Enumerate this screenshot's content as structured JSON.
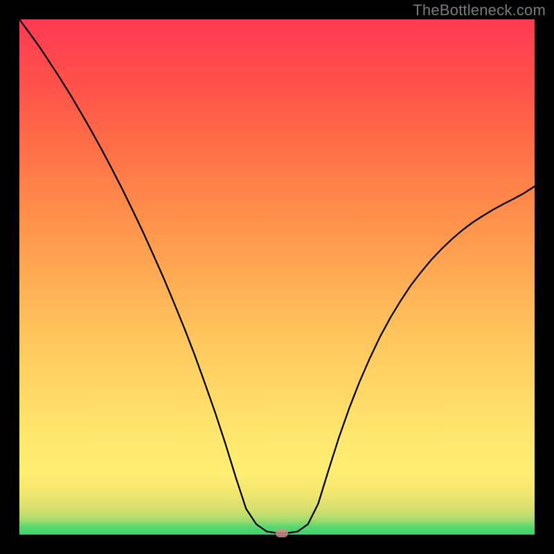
{
  "watermark": "TheBottleneck.com",
  "chart_data": {
    "type": "line",
    "title": "",
    "xlabel": "",
    "ylabel": "",
    "xlim": [
      0,
      1
    ],
    "ylim": [
      0,
      1
    ],
    "x": [
      0.0,
      0.02,
      0.04,
      0.06,
      0.08,
      0.1,
      0.12,
      0.14,
      0.16,
      0.18,
      0.2,
      0.22,
      0.24,
      0.26,
      0.28,
      0.3,
      0.32,
      0.34,
      0.36,
      0.38,
      0.4,
      0.42,
      0.44,
      0.46,
      0.48,
      0.5,
      0.52,
      0.54,
      0.56,
      0.58,
      0.6,
      0.62,
      0.64,
      0.66,
      0.68,
      0.7,
      0.72,
      0.74,
      0.76,
      0.78,
      0.8,
      0.82,
      0.84,
      0.86,
      0.88,
      0.9,
      0.92,
      0.94,
      0.96,
      0.98,
      1.0
    ],
    "values": [
      1.0,
      0.973,
      0.945,
      0.915,
      0.884,
      0.852,
      0.818,
      0.783,
      0.747,
      0.709,
      0.67,
      0.629,
      0.587,
      0.543,
      0.498,
      0.45,
      0.401,
      0.349,
      0.294,
      0.237,
      0.176,
      0.111,
      0.05,
      0.02,
      0.006,
      0.003,
      0.003,
      0.006,
      0.02,
      0.06,
      0.125,
      0.188,
      0.245,
      0.296,
      0.342,
      0.384,
      0.421,
      0.454,
      0.484,
      0.51,
      0.534,
      0.555,
      0.574,
      0.591,
      0.606,
      0.619,
      0.631,
      0.642,
      0.652,
      0.663,
      0.676
    ],
    "background_gradient": {
      "top": "#ff3a53",
      "bottom": "#39d36b"
    },
    "marker": {
      "x": 0.51,
      "y": 0.003,
      "color": "#d28b8e"
    }
  }
}
